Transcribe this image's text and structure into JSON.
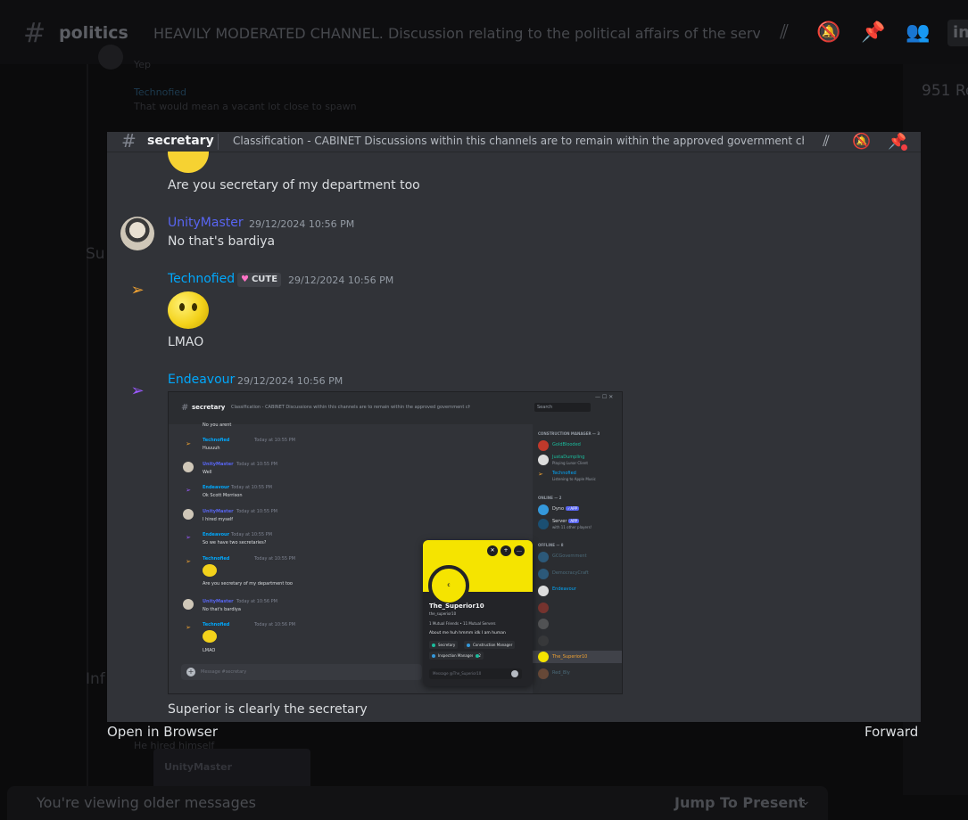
{
  "background": {
    "channel_name": "politics",
    "topic": "HEAVILY MODERATED CHANNEL. Discussion relating to the political affairs of the server...",
    "pill_text": "in",
    "right_panel_text": "951 Re",
    "faint_msg_1": "Yep",
    "faint_author": "Technofied",
    "faint_msg_2": "That would mean a vacant lot close to spawn",
    "faint_side_1": "Su",
    "faint_side_2": "Inf",
    "faint_msg_3": "He hired himself",
    "faint_embed_name": "UnityMaster",
    "older_messages": "You're viewing older messages",
    "jump_to_present": "Jump To Present"
  },
  "viewer": {
    "channel_name": "secretary",
    "topic": "Classification - CABINET Discussions within this channels are to remain within the approved government cha...",
    "messages": [
      {
        "text": "Are you secretary of my department too"
      },
      {
        "author": "UnityMaster",
        "timestamp": "29/12/2024 10:56 PM",
        "text": "No that's bardiya"
      },
      {
        "author": "Technofied",
        "badge": "CUTE",
        "timestamp": "29/12/2024 10:56 PM",
        "text": "LMAO"
      },
      {
        "author": "Endeavour",
        "timestamp": "29/12/2024 10:56 PM"
      }
    ],
    "caption": "Superior is clearly the secretary",
    "open_in_browser": "Open in Browser",
    "forward": "Forward",
    "colors": {
      "unity": "#5865f2",
      "technofied": "#00a8fc",
      "endeavour": "#00a8fc"
    }
  },
  "screenshot": {
    "channel": "secretary",
    "topic": "Classification - CABINET Discussions within this channels are to remain within the approved government cha...",
    "search": "Search",
    "input_placeholder": "Message #secretary",
    "msgs": [
      {
        "author": "",
        "ts": "",
        "text": "No you arent"
      },
      {
        "author": "Technofied",
        "ts": "Today at 10:55 PM",
        "text": "Huuuuh"
      },
      {
        "author": "UnityMaster",
        "ts": "Today at 10:55 PM",
        "text": "Well"
      },
      {
        "author": "Endeavour",
        "ts": "Today at 10:55 PM",
        "text": "Ok Scott Morrison"
      },
      {
        "author": "UnityMaster",
        "ts": "Today at 10:55 PM",
        "text": "I hired myself"
      },
      {
        "author": "Endeavour",
        "ts": "Today at 10:55 PM",
        "text": "So we have two secretaries?"
      },
      {
        "author": "Technofied",
        "ts": "Today at 10:55 PM",
        "text": "Are you secretary of my department too"
      },
      {
        "author": "UnityMaster",
        "ts": "Today at 10:56 PM",
        "text": "No that's bardiya"
      },
      {
        "author": "Technofied",
        "ts": "Today at 10:56 PM",
        "text": "LMAO"
      }
    ],
    "members": {
      "construction_manager": "CONSTRUCTION MANAGER — 3",
      "online": "ONLINE — 2",
      "offline": "OFFLINE — 8",
      "names": [
        "GoldBlooded",
        "JustaDumpling",
        "Technofied",
        "Dyno",
        "Server",
        "GCGovernment",
        "DemocracyCraft",
        "Endeavour",
        "The_Superior10",
        "Red_Bly"
      ],
      "status_dumpling": "Playing Lunar Client",
      "status_tech": "Listening to Apple Music",
      "status_server": "with 11 other players!"
    },
    "popup": {
      "name": "The_Superior10",
      "username": "the_superior10",
      "mutuals": "1 Mutual Friends • 11 Mutual Servers",
      "about": "About me huh hmmm idk I am human",
      "role_1": "Secretary",
      "role_2": "Construction Manager",
      "role_3": "Inspection Manager",
      "role_more": "+2",
      "msg_placeholder": "Message @The_Superior10"
    }
  }
}
